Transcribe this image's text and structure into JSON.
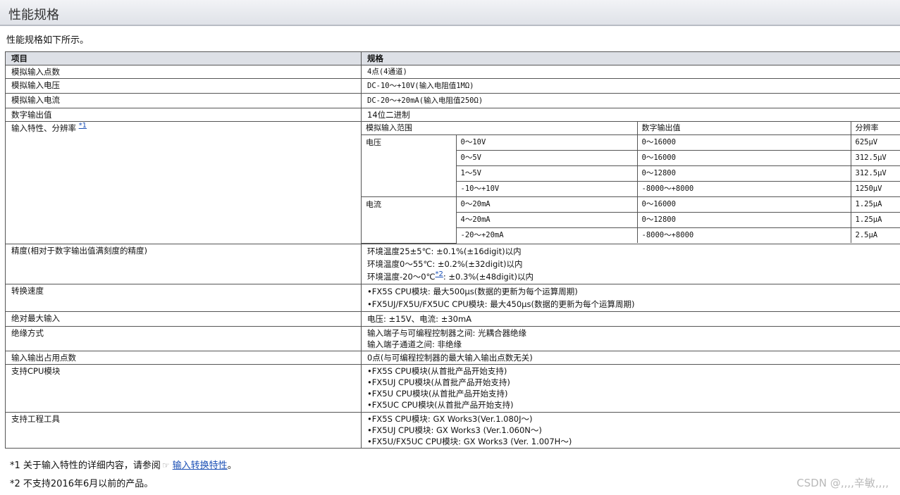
{
  "header": {
    "title": "性能规格"
  },
  "intro": "性能规格如下所示。",
  "table": {
    "col_item": "项目",
    "col_spec": "规格",
    "rows": [
      {
        "item": "模拟输入点数",
        "value": "4点(4通道)"
      },
      {
        "item": "模拟输入电压",
        "value": "DC-10～+10V(输入电阻值1MΩ)"
      },
      {
        "item": "模拟输入电流",
        "value": "DC-20～+20mA(输入电阻值250Ω)"
      },
      {
        "item": "数字输出值",
        "value": "14位二进制"
      }
    ],
    "characteristics": {
      "item": "输入特性、分辨率",
      "note": "*1",
      "headers": [
        "模拟输入范围",
        "数字输出值",
        "分辨率"
      ],
      "voltage_label": "电压",
      "current_label": "电流",
      "voltage_rows": [
        {
          "range": "0～10V",
          "output": "0～16000",
          "res": "625μV"
        },
        {
          "range": "0～5V",
          "output": "0～16000",
          "res": "312.5μV"
        },
        {
          "range": "1～5V",
          "output": "0～12800",
          "res": "312.5μV"
        },
        {
          "range": "-10～+10V",
          "output": "-8000～+8000",
          "res": "1250μV"
        }
      ],
      "current_rows": [
        {
          "range": "0～20mA",
          "output": "0～16000",
          "res": "1.25μA"
        },
        {
          "range": "4～20mA",
          "output": "0～12800",
          "res": "1.25μA"
        },
        {
          "range": "-20～+20mA",
          "output": "-8000～+8000",
          "res": "2.5μA"
        }
      ]
    },
    "accuracy": {
      "item": "精度(相对于数字输出值满刻度的精度)",
      "line1": "环境温度25±5℃: ±0.1%(±16digit)以内",
      "line2": "环境温度0～55℃: ±0.2%(±32digit)以内",
      "line3_pre": "环境温度-20～0℃",
      "line3_note": "*2",
      "line3_post": ": ±0.3%(±48digit)以内"
    },
    "speed": {
      "item": "转换速度",
      "lines": [
        "•FX5S CPU模块: 最大500μs(数据的更新为每个运算周期)",
        "•FX5UJ/FX5U/FX5UC CPU模块: 最大450μs(数据的更新为每个运算周期)"
      ]
    },
    "abs_max": {
      "item": "绝对最大输入",
      "value": "电压: ±15V、电流: ±30mA"
    },
    "isolation": {
      "item": "绝缘方式",
      "lines": [
        "输入端子与可编程控制器之间: 光耦合器绝缘",
        "输入端子通道之间: 非绝缘"
      ]
    },
    "io_points": {
      "item": "输入输出占用点数",
      "value": "0点(与可编程控制器的最大输入输出点数无关)"
    },
    "cpu_support": {
      "item": "支持CPU模块",
      "lines": [
        "•FX5S CPU模块(从首批产品开始支持)",
        "•FX5UJ CPU模块(从首批产品开始支持)",
        "•FX5U CPU模块(从首批产品开始支持)",
        "•FX5UC CPU模块(从首批产品开始支持)"
      ]
    },
    "tools": {
      "item": "支持工程工具",
      "lines": [
        "•FX5S CPU模块: GX Works3(Ver.1.080J～)",
        "•FX5UJ CPU模块: GX Works3 (Ver.1.060N～)",
        "•FX5U/FX5UC CPU模块: GX Works3 (Ver. 1.007H～)"
      ]
    }
  },
  "footnotes": {
    "fn1_pre": "*1 关于输入特性的详细内容，请参阅",
    "fn1_link": "输入转换特性",
    "fn1_post": "。",
    "fn2": "*2 不支持2016年6月以前的产品。"
  },
  "watermark": "CSDN @,,,,辛敏,,,,"
}
